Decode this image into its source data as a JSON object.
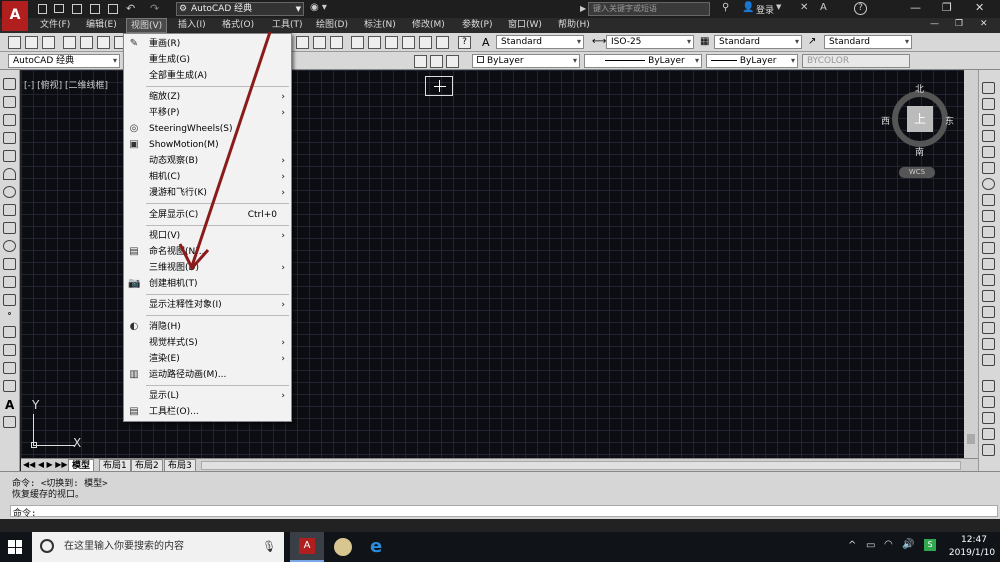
{
  "titlebar": {
    "workspace": "AutoCAD 经典",
    "search_placeholder": "键入关键字或短语",
    "login": "登录",
    "help": "?"
  },
  "menubar": [
    {
      "label": "文件(F)"
    },
    {
      "label": "编辑(E)"
    },
    {
      "label": "视图(V)"
    },
    {
      "label": "插入(I)"
    },
    {
      "label": "格式(O)"
    },
    {
      "label": "工具(T)"
    },
    {
      "label": "绘图(D)"
    },
    {
      "label": "标注(N)"
    },
    {
      "label": "修改(M)"
    },
    {
      "label": "参数(P)"
    },
    {
      "label": "窗口(W)"
    },
    {
      "label": "帮助(H)"
    }
  ],
  "styles": {
    "text_style": "Standard",
    "dim_style": "ISO-25",
    "table_style": "Standard",
    "multileader_style": "Standard"
  },
  "layers": {
    "workspace_combo": "AutoCAD 经典",
    "layer": "ByLayer",
    "linetype": "ByLayer",
    "lineweight": "ByLayer",
    "plotstyle": "BYCOLOR"
  },
  "viewport": {
    "label": "[-] [俯视] [二维线框]",
    "compass_n": "北",
    "compass_s": "南",
    "compass_e": "东",
    "compass_w": "西",
    "compass_center": "上",
    "wcs": "WCS",
    "axis_y": "Y",
    "axis_x": "X"
  },
  "view_menu": {
    "items": [
      {
        "label": "重画(R)",
        "icon": "redraw-icon",
        "sub": false
      },
      {
        "label": "重生成(G)",
        "icon": "",
        "sub": false
      },
      {
        "label": "全部重生成(A)",
        "icon": "",
        "sub": false
      },
      {
        "label": "缩放(Z)",
        "icon": "",
        "sub": true
      },
      {
        "label": "平移(P)",
        "icon": "",
        "sub": true
      },
      {
        "label": "SteeringWheels(S)",
        "icon": "steeringwheels-icon",
        "sub": false
      },
      {
        "label": "ShowMotion(M)",
        "icon": "showmotion-icon",
        "sub": false
      },
      {
        "label": "动态观察(B)",
        "icon": "",
        "sub": true
      },
      {
        "label": "相机(C)",
        "icon": "",
        "sub": true
      },
      {
        "label": "漫游和飞行(K)",
        "icon": "",
        "sub": true
      },
      {
        "label": "全屏显示(C)",
        "icon": "",
        "sub": false,
        "shortcut": "Ctrl+0"
      },
      {
        "label": "视口(V)",
        "icon": "",
        "sub": true
      },
      {
        "label": "命名视图(N)...",
        "icon": "named-view-icon",
        "sub": false
      },
      {
        "label": "三维视图(D)",
        "icon": "",
        "sub": true
      },
      {
        "label": "创建相机(T)",
        "icon": "camera-icon",
        "sub": false
      },
      {
        "label": "显示注释性对象(I)",
        "icon": "",
        "sub": true
      },
      {
        "label": "消隐(H)",
        "icon": "hide-icon",
        "sub": false
      },
      {
        "label": "视觉样式(S)",
        "icon": "",
        "sub": true
      },
      {
        "label": "渲染(E)",
        "icon": "",
        "sub": true
      },
      {
        "label": "运动路径动画(M)...",
        "icon": "motion-path-icon",
        "sub": false
      },
      {
        "label": "显示(L)",
        "icon": "",
        "sub": true
      },
      {
        "label": "工具栏(O)...",
        "icon": "toolbar-icon",
        "sub": false
      }
    ]
  },
  "tabs": [
    {
      "label": "模型"
    },
    {
      "label": "布局1"
    },
    {
      "label": "布局2"
    },
    {
      "label": "布局3"
    }
  ],
  "command": {
    "line1": "命令:   <切换到: 模型>",
    "line2": "恢复缓存的视口。",
    "prompt": "命令:"
  },
  "taskbar": {
    "search_placeholder": "在这里输入你要搜索的内容",
    "time": "12:47",
    "date": "2019/1/10"
  },
  "colors": {
    "annotation_arrow": "#8b1a1a",
    "menu_bg": "#f2f2f2",
    "drawing_bg": "#0b0d12"
  }
}
